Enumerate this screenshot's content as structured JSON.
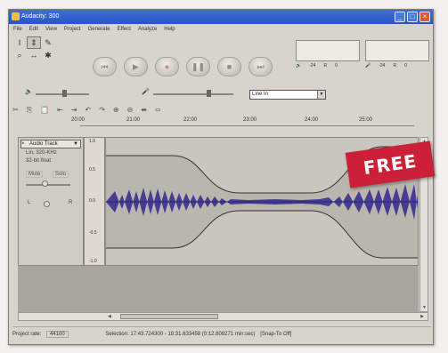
{
  "window": {
    "title": "Audacity: 300"
  },
  "menu": [
    "File",
    "Edit",
    "View",
    "Project",
    "Generate",
    "Effect",
    "Analyze",
    "Help"
  ],
  "tools": [
    "selection-tool",
    "envelope-tool",
    "draw-tool",
    "zoom-tool",
    "timeshift-tool",
    "multi-tool"
  ],
  "transport": [
    "rewind",
    "play",
    "record",
    "pause",
    "stop",
    "fast-forward"
  ],
  "meters": {
    "output": {
      "channel_label": "R",
      "ticks": [
        "-24",
        "0"
      ]
    },
    "input": {
      "channel_label": "R",
      "ticks": [
        "-24",
        "0"
      ]
    }
  },
  "input_source": "Line In",
  "timeline_ticks": [
    "20:00",
    "21:00",
    "22:00",
    "23:00",
    "24:00",
    "25:00"
  ],
  "track": {
    "name": "Audio Track",
    "rate": "Lin, 320-KHz",
    "format": "32-bit float",
    "mute": "Mute",
    "solo": "Solo",
    "left_label": "L",
    "right_label": "R",
    "ruler": [
      "1.0",
      "0.5",
      "0.0",
      "-0.5",
      "-1.0"
    ]
  },
  "badge": "FREE",
  "status": {
    "project_rate_label": "Project rate:",
    "project_rate": "44100",
    "selection": "Selection: 17:43.724300 - 18:31.633458 (0:12.808271 min:sec)",
    "snap": "[Snap-To Off]"
  }
}
